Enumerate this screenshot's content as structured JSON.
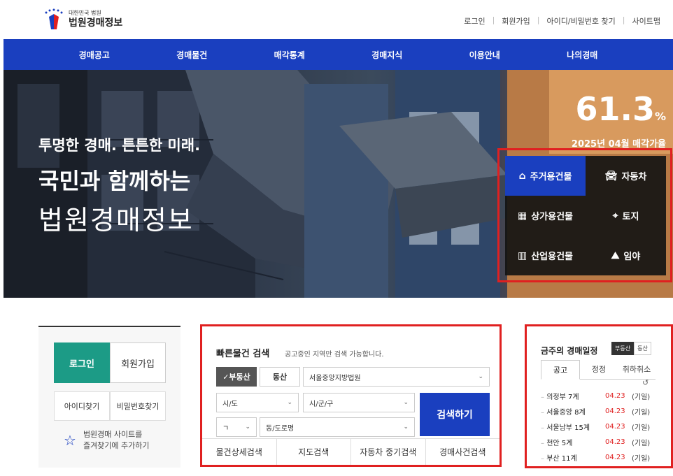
{
  "header": {
    "logo_small": "대한민국 법원",
    "logo_big": "법원경매정보",
    "util": [
      "로그인",
      "회원가입",
      "아이디/비밀번호 찾기",
      "사이트맵"
    ]
  },
  "nav": [
    "경매공고",
    "경매물건",
    "매각통계",
    "경매지식",
    "이용안내",
    "나의경매"
  ],
  "hero": {
    "line1": "투명한 경매. 튼튼한 미래.",
    "line2": "국민과 함께하는",
    "line3": "법원경매정보",
    "rate_value": "61.3",
    "rate_unit": "%",
    "rate_label": "2025년 04월 매각가율"
  },
  "categories": [
    {
      "label": "주거용건물",
      "icon": "house-icon"
    },
    {
      "label": "자동차",
      "icon": "car-icon"
    },
    {
      "label": "상가용건물",
      "icon": "store-building-icon"
    },
    {
      "label": "토지",
      "icon": "location-pin-icon"
    },
    {
      "label": "산업용건물",
      "icon": "factory-building-icon"
    },
    {
      "label": "임야",
      "icon": "mountain-icon"
    }
  ],
  "login_box": {
    "login": "로그인",
    "join": "회원가입",
    "find_id": "아이디찾기",
    "find_pw": "비밀번호찾기",
    "fav_line1": "법원경매 사이트를",
    "fav_line2": "즐겨찾기에 추가하기"
  },
  "quick_search": {
    "title": "빠른물건 검색",
    "subtitle": "공고중인 지역만 검색 가능합니다.",
    "real_estate": "✓부동산",
    "movable": "동산",
    "court": "서울중앙지방법원",
    "sido": "시/도",
    "sigungu": "시/군/구",
    "initial": "ㄱ",
    "dong": "동/도로명",
    "search_button": "검색하기",
    "tabs": [
      "물건상세검색",
      "지도검색",
      "자동차 중기검색",
      "경매사건검색"
    ]
  },
  "schedule": {
    "title": "금주의 경매일정",
    "toggle_on": "부동산",
    "toggle_off": "동산",
    "tabs": [
      "공고",
      "정정",
      "취하취소"
    ],
    "refresh": "↺",
    "rows": [
      {
        "name": "의정부 7계",
        "date": "04.23",
        "status": "(기일)"
      },
      {
        "name": "서울중앙 8계",
        "date": "04.23",
        "status": "(기일)"
      },
      {
        "name": "서울남부 15계",
        "date": "04.23",
        "status": "(기일)"
      },
      {
        "name": "천안 5계",
        "date": "04.23",
        "status": "(기일)"
      },
      {
        "name": "부산 11계",
        "date": "04.23",
        "status": "(기일)"
      }
    ]
  },
  "colors": {
    "brand_blue": "#1a3fbf",
    "login_green": "#1c9b86",
    "highlight_red": "#e02020"
  }
}
